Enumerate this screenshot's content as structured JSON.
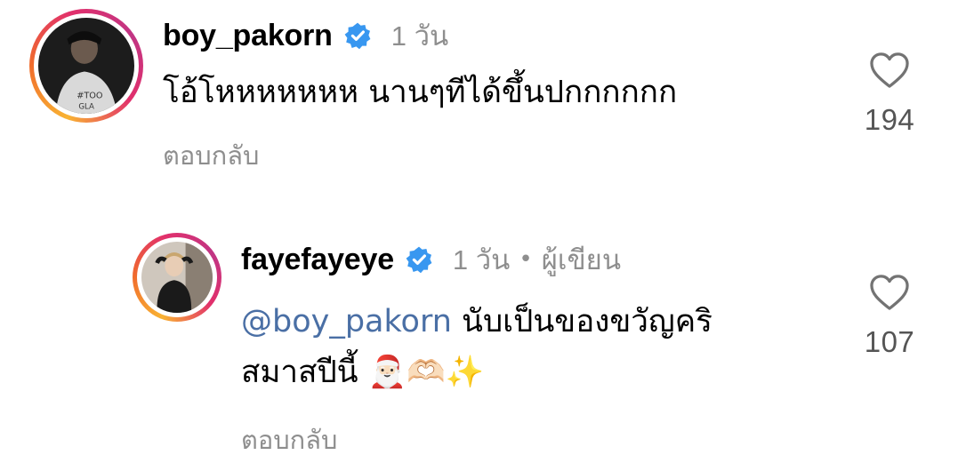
{
  "comments": [
    {
      "username": "boy_pakorn",
      "verified": true,
      "time": "1 วัน",
      "text": "โอ้โหหหหหหห นานๆทีได้ขึ้นปกกกกกก",
      "reply_label": "ตอบกลับ",
      "likes": "194",
      "avatar": "profile-photo-man-hat",
      "icon": "heart-outline-icon"
    },
    {
      "username": "fayefayeye",
      "verified": true,
      "time": "1 วัน",
      "separator": "•",
      "author_badge": "ผู้เขียน",
      "mention": "@boy_pakorn",
      "text_line1": " นับเป็นของขวัญคริ",
      "text_line2": "สมาสปีนี้ ",
      "emojis": [
        "🎅🏻",
        "🫶🏻",
        "✨"
      ],
      "reply_label": "ตอบกลับ",
      "likes": "107",
      "avatar": "profile-photo-woman",
      "icon": "heart-outline-icon"
    }
  ],
  "colors": {
    "text": "#000000",
    "secondary": "#8e8e8e",
    "mention": "#4a6fa5",
    "verified": "#3897f0"
  }
}
